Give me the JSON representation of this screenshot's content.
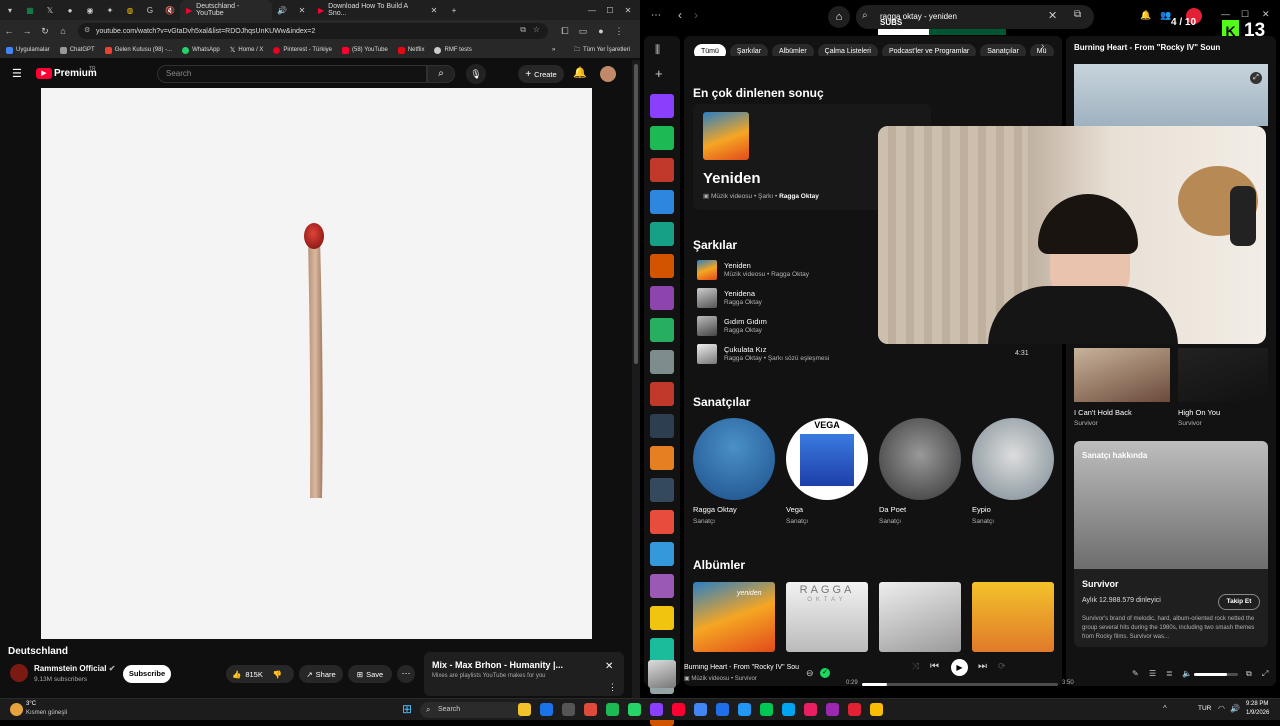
{
  "chrome": {
    "tabs": [
      {
        "title": "Deutschland - YouTube"
      },
      {
        "title": "Download How To Build A Sno..."
      }
    ],
    "url": "youtube.com/watch?v=vGtaDvh5xal&list=RDOJhqsUnKUWw&index=2",
    "bookmarks": [
      "Uygulamalar",
      "ChatGPT",
      "Gelen Kutusu (98) -...",
      "WhatsApp",
      "Home / X",
      "Pinterest - Türkiye",
      "(58) YouTube",
      "Netflix",
      "RMF tests"
    ],
    "all_bookmarks": "Tüm Yer İşaretleri"
  },
  "youtube": {
    "logo": "Premium",
    "logo_region": "TR",
    "search_placeholder": "Search",
    "create_label": "Create",
    "video_title": "Deutschland",
    "channel": "Rammstein Official",
    "subscribers": "9.13M subscribers",
    "subscribe_label": "Subscribe",
    "likes": "815K",
    "share_label": "Share",
    "save_label": "Save",
    "mix_title": "Mix - Max Brhon - Humanity |...",
    "mix_sub": "Mixes are playlists YouTube makes for you"
  },
  "spotify": {
    "search_value": "ragga oktay - yeniden",
    "filters": [
      "Tümü",
      "Şarkılar",
      "Albümler",
      "Çalma Listeleri",
      "Podcast'ler ve Programlar",
      "Sanatçılar",
      "Mü"
    ],
    "top_result_heading": "En çok dinlenen sonuç",
    "top_result": {
      "title": "Yeniden",
      "type": "Müzik videosu",
      "kind": "Şarkı",
      "artist": "Ragga Oktay"
    },
    "songs_heading": "Şarkılar",
    "songs": [
      {
        "title": "Yeniden",
        "sub": "Müzik videosu • Ragga Oktay"
      },
      {
        "title": "Yenidena",
        "sub": "Ragga Oktay"
      },
      {
        "title": "Gıdım Gıdım",
        "sub": "Ragga Oktay"
      },
      {
        "title": "Çukulata Kız",
        "sub": "Ragga Oktay • Şarkı sözü eşleşmesi"
      }
    ],
    "artists_heading": "Sanatçılar",
    "artists": [
      {
        "name": "Ragga Oktay",
        "role": "Sanatçı"
      },
      {
        "name": "Vega",
        "role": "Sanatçı"
      },
      {
        "name": "Da Poet",
        "role": "Sanatçı"
      },
      {
        "name": "Eypio",
        "role": "Sanatçı"
      }
    ],
    "albums_heading": "Albümler",
    "album_art_text": [
      "yeniden",
      "RAGGA",
      "OKTAY"
    ],
    "vega_art_text": "VEGA",
    "now_playing_panel": {
      "title": "Burning Heart - From \"Rocky IV\" Soun",
      "related": [
        {
          "title": "I Can't Hold Back",
          "artist": "Survivor"
        },
        {
          "title": "High On You",
          "artist": "Survivor"
        }
      ],
      "about_label": "Sanatçı hakkında",
      "artist": "Survivor",
      "listeners": "Aylık 12.988.579 dinleyici",
      "follow_label": "Takip Et",
      "bio": "Survivor's brand of melodic, hard, album-oriented rock netted the group several hits during the 1980s, including two smash themes from Rocky films. Survivor was..."
    },
    "player": {
      "title": "Burning Heart - From \"Rocky IV\" Sou",
      "type": "Müzik videosu",
      "artist": "Survivor",
      "elapsed": "0:29",
      "total": "3:50",
      "progress": 0.13,
      "volume": 0.75
    },
    "overlay": {
      "subs_label": "SUBS",
      "subs_progress": "4 / 10",
      "subs_fraction": 0.4,
      "kick_count": "13",
      "cam_time": "4:31"
    }
  },
  "taskbar": {
    "weather_temp": "3°C",
    "weather_desc": "Kısmen güneşli",
    "search": "Search",
    "lang": "TUR",
    "time": "9:28 PM",
    "date": "1/9/2026"
  },
  "colors": {
    "youtube_red": "#ff0033",
    "spotify_green": "#1ed760",
    "kick_green": "#53fc18",
    "bg_dark": "#121212"
  }
}
